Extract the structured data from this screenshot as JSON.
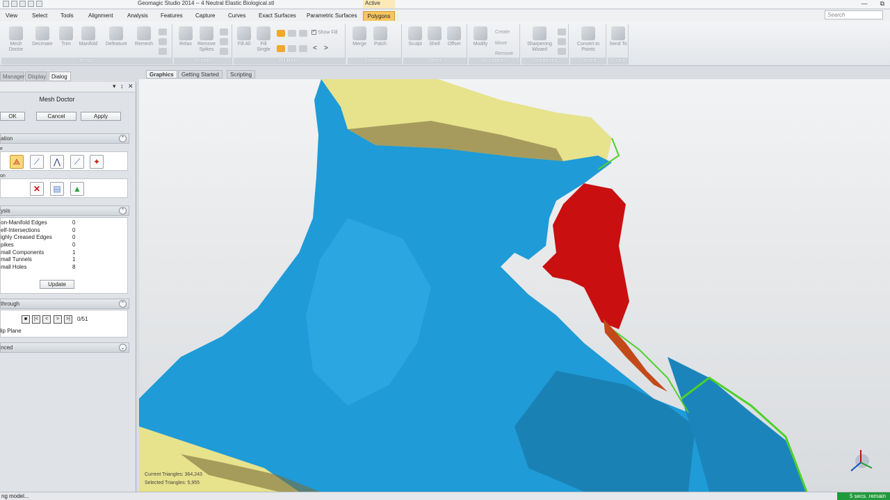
{
  "window": {
    "title": "Geomagic Studio 2014 -- 4 Neutral Elastic Biological.stl",
    "active_label": "Active",
    "minimize": "—",
    "restore": "⧉"
  },
  "menu": {
    "tabs": [
      "View",
      "Select",
      "Tools",
      "Alignment",
      "Analysis",
      "Features",
      "Capture",
      "Curves",
      "Exact Surfaces",
      "Parametric Surfaces",
      "Polygons"
    ],
    "selected": "Polygons",
    "search_placeholder": "Search"
  },
  "ribbon": {
    "groups": [
      {
        "label": "Repair",
        "buttons": [
          "Mesh Doctor",
          "Decimate",
          "Trim",
          "Manifold",
          "Defeature",
          "Remesh"
        ]
      },
      {
        "label": "Smooth",
        "buttons": [
          "Relax",
          "Remove Spikes"
        ]
      },
      {
        "label": "Fill Holes",
        "buttons": [
          "Fill All",
          "Fill Single"
        ],
        "checkbox": "Show Fill"
      },
      {
        "label": "Combine",
        "buttons": [
          "Merge",
          "Patch"
        ]
      },
      {
        "label": "Offset",
        "buttons": [
          "Sculpt",
          "Shell",
          "Offset"
        ]
      },
      {
        "label": "Boundaries",
        "buttons": [
          "Modify",
          "Create",
          "Move",
          "Remove"
        ]
      },
      {
        "label": "Sharpening",
        "buttons": [
          "Sharpening Wizard"
        ]
      },
      {
        "label": "Convert",
        "buttons": [
          "Convert to Points"
        ]
      },
      {
        "label": "Output",
        "buttons": [
          "Send To"
        ]
      }
    ]
  },
  "left_panel": {
    "tabs": [
      "Manager",
      "Display",
      "Dialog"
    ],
    "selected_tab": "Dialog",
    "header_icons": {
      "pin": "▾",
      "float": "↕",
      "close": "✕"
    },
    "title": "Mesh Doctor",
    "buttons": {
      "ok": "OK",
      "cancel": "Cancel",
      "apply": "Apply"
    },
    "sections": {
      "operation": "ation",
      "analysis": "ysis",
      "stepthrough": "through",
      "advanced": "nced",
      "chevron": "⌃"
    },
    "subsection_labels": [
      "e",
      "on"
    ],
    "analysis_rows": [
      {
        "label": "on-Manifold Edges",
        "value": "0"
      },
      {
        "label": "elf-Intersections",
        "value": "0"
      },
      {
        "label": "ighly Creased Edges",
        "value": "0"
      },
      {
        "label": "pikes",
        "value": "0"
      },
      {
        "label": "mall Components",
        "value": "1"
      },
      {
        "label": "mall Tunnels",
        "value": "1"
      },
      {
        "label": "mall Holes",
        "value": "8"
      }
    ],
    "update_label": "Update",
    "counter": "0/51",
    "clip_plane_label": "lip Plane"
  },
  "graphics": {
    "tabs": [
      "Graphics",
      "Getting Started",
      "Scripting"
    ],
    "selected_tab": "Graphics",
    "current_triangles": "Current Triangles: 364,243",
    "selected_triangles": "Selected Triangles: 5,955",
    "colors": {
      "mesh_blue": "#1e9ad6",
      "backface_yellow": "#e6e08a",
      "selected_red": "#cc1010",
      "edge_green": "#4ed02a"
    }
  },
  "status": {
    "left": "ng model...",
    "right": "5 secs. remain"
  }
}
